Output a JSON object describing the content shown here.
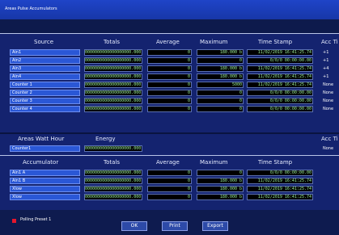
{
  "window": {
    "title": "Areas Pulse Accumulators"
  },
  "section1": {
    "headers": {
      "source": "Source",
      "totals": "Totals",
      "average": "Average",
      "maximum": "Maximum",
      "timestamp": "Time Stamp",
      "acc": "Acc Ti"
    },
    "rows": [
      {
        "label": "Ain1",
        "totals": "0000000000000000000.000",
        "average": "0",
        "maximum": "180.000 b",
        "timestamp": "11/02/2019 16:41:25.74",
        "acc": "+1"
      },
      {
        "label": "Ain2",
        "totals": "0000000000000000000.000",
        "average": "0",
        "maximum": "0",
        "timestamp": "0/0/0 00:00:00.00",
        "acc": "+1"
      },
      {
        "label": "Ain3",
        "totals": "0000000000000000000.000",
        "average": "0",
        "maximum": "180.000 b",
        "timestamp": "11/02/2019 16:41:25.74",
        "acc": "+4"
      },
      {
        "label": "Ain4",
        "totals": "0000000000000000000.000",
        "average": "0",
        "maximum": "180.000 b",
        "timestamp": "11/02/2019 16:41:25.74",
        "acc": "+1"
      },
      {
        "label": "Counter 1",
        "totals": "0000000000000000000.000",
        "average": "0",
        "maximum": "5000",
        "timestamp": "11/02/2019 16:41:25.74",
        "acc": "None"
      },
      {
        "label": "Counter 2",
        "totals": "0000000000000000000.000",
        "average": "0",
        "maximum": "0",
        "timestamp": "0/0/0 00:00:00.00",
        "acc": "None"
      },
      {
        "label": "Counter 3",
        "totals": "0000000000000000000.000",
        "average": "0",
        "maximum": "0",
        "timestamp": "0/0/0 00:00:00.00",
        "acc": "None"
      },
      {
        "label": "Counter 4",
        "totals": "0000000000000000000.000",
        "average": "0",
        "maximum": "0",
        "timestamp": "0/0/0 00:00:00.00",
        "acc": "None"
      }
    ]
  },
  "section2": {
    "headers": {
      "source": "Areas Watt Hour",
      "energy": "Energy",
      "acc": "Acc Ti"
    },
    "rows": [
      {
        "label": "Counter1",
        "energy": "0000000000000000000.000",
        "acc": "None"
      }
    ]
  },
  "section3": {
    "headers": {
      "source": "Accumulator",
      "totals": "Totals",
      "average": "Average",
      "maximum": "Maximum",
      "timestamp": "Time Stamp"
    },
    "rows": [
      {
        "label": "Ain1 A",
        "totals": "0000000000000000000.000",
        "average": "0",
        "maximum": "0",
        "timestamp": "0/0/0 00:00:00.00"
      },
      {
        "label": "Ain1 B",
        "totals": "0000000000000000000.000",
        "average": "0",
        "maximum": "180.000 b",
        "timestamp": "11/02/2019 16:41:25.74"
      },
      {
        "label": "Xlow",
        "totals": "0000000000000000000.000",
        "average": "0",
        "maximum": "180.000 b",
        "timestamp": "11/02/2019 16:41:25.74"
      },
      {
        "label": "Xlow",
        "totals": "0000000000000000000.000",
        "average": "0",
        "maximum": "180.000 b",
        "timestamp": "11/02/2019 16:41:25.74"
      }
    ]
  },
  "footer": {
    "polling_label": "Polling Preset 1",
    "ok_label": "OK",
    "print_label": "Print",
    "export_label": "Export"
  }
}
